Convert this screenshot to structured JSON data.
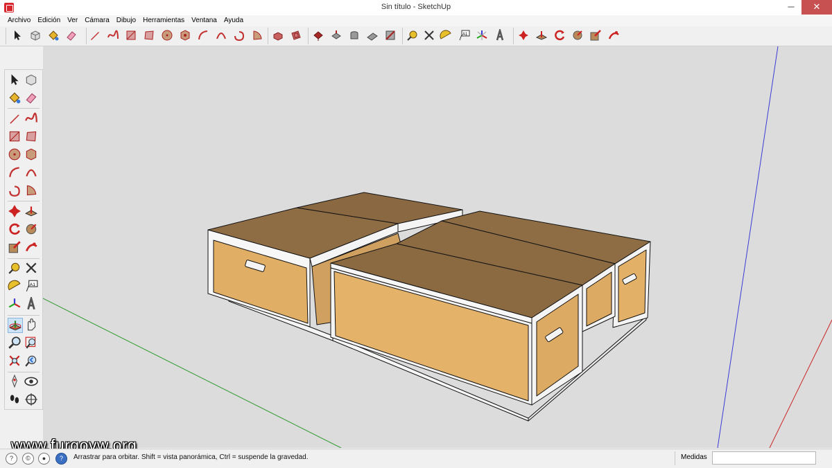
{
  "window": {
    "title": "Sin título - SketchUp",
    "minimize": "─",
    "maximize": "□",
    "close": "✕"
  },
  "menu": [
    "Archivo",
    "Edición",
    "Ver",
    "Cámara",
    "Dibujo",
    "Herramientas",
    "Ventana",
    "Ayuda"
  ],
  "toolbar_icons": [
    "select-icon",
    "component-icon",
    "paint-bucket-icon",
    "eraser-icon",
    "pencil-line-icon",
    "freehand-icon",
    "rectangle-icon",
    "rotated-rectangle-icon",
    "circle-icon",
    "polygon-icon",
    "arc-icon",
    "two-point-arc-icon",
    "three-point-arc-icon",
    "pie-icon",
    "push-pull-icon",
    "offset-icon",
    "move-icon",
    "follow-me-icon",
    "rotate-icon",
    "scale-icon",
    "intersect-icon",
    "tape-measure-icon",
    "dimension-icon",
    "protractor-icon",
    "text-icon",
    "axes-icon",
    "3d-text-icon",
    "orbit-icon",
    "pan-icon",
    "zoom-icon",
    "zoom-window-icon",
    "zoom-extents-icon",
    "walk-icon"
  ],
  "left_icons": [
    "select-icon",
    "component-icon",
    "paint-bucket-icon",
    "eraser-icon",
    "line-icon",
    "freehand-icon",
    "rectangle-icon",
    "rotated-rectangle-icon",
    "circle-icon",
    "polygon-icon",
    "arc-icon",
    "two-point-arc-icon",
    "three-point-arc-icon",
    "pie-icon",
    "move-icon",
    "push-pull-icon",
    "rotate-icon",
    "follow-me-icon",
    "scale-icon",
    "offset-icon",
    "tape-measure-icon",
    "dimension-icon",
    "protractor-icon",
    "text-icon",
    "axes-icon",
    "3d-text-icon",
    "orbit-icon",
    "pan-icon",
    "zoom-icon",
    "zoom-window-icon",
    "zoom-extents-icon",
    "previous-view-icon",
    "position-camera-icon",
    "look-around-icon",
    "walk-icon",
    "section-plane-icon"
  ],
  "statusbar": {
    "hint": "Arrastrar para orbitar. Shift = vista panorámica, Ctrl = suspende la gravedad.",
    "measure_label": "Medidas",
    "measure_value": ""
  },
  "watermark": "www.furgovw.org",
  "colors": {
    "viewport_bg": "#dcdcdc",
    "wood_top": "#8c6b43",
    "wood_side": "#e3b067",
    "frame_white": "#f7f7f7",
    "axis_green": "#2e9a2e",
    "axis_blue": "#3a3ad6",
    "axis_red": "#cc2222"
  }
}
